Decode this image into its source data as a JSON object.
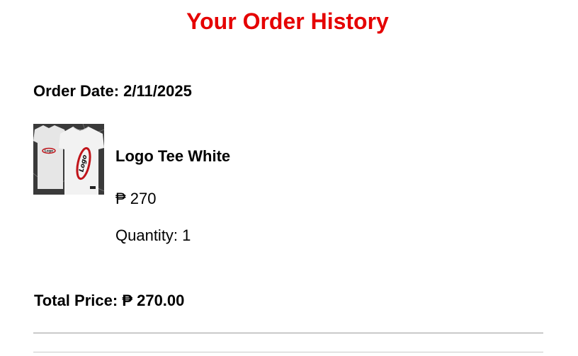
{
  "page": {
    "title": "Your Order History"
  },
  "order": {
    "date_label": "Order Date:",
    "date": "2/11/2025",
    "items": [
      {
        "name": "Logo Tee White",
        "price": "₱ 270",
        "quantity_label": "Quantity:",
        "quantity": "1",
        "image_alt": "Logo Tee White product photo"
      }
    ],
    "total_label": "Total Price:",
    "total": "₱ 270.00"
  },
  "colors": {
    "title": "#e50000",
    "text": "#000000",
    "divider": "#9a9a9a"
  }
}
